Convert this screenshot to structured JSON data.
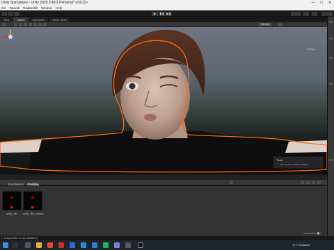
{
  "window": {
    "title": "Unity Standalone - Unity 2020.3.41f1 Personal* <DX11>",
    "controls": [
      "—",
      "☐",
      "✕"
    ]
  },
  "menu": [
    "ent",
    "Tutorial",
    "Realtoolkit",
    "Window",
    "Help"
  ],
  "toolbar": {
    "play_icon": "play-icon",
    "pause_icon": "pause-icon",
    "step_icon": "step-icon"
  },
  "tabs": [
    {
      "label": "Shot",
      "active": false
    },
    {
      "label": "Scene",
      "active": true
    },
    {
      "label": "Animation",
      "active": false
    },
    {
      "label": "Asset Store",
      "active": false
    }
  ],
  "scene": {
    "shading_mode": "Gizmos",
    "projection_label": "< Persp",
    "tools_overlay_title": "Tools",
    "tools_overlay_sub": "No custom tools available"
  },
  "project": {
    "breadcrumb": [
      "...",
      "Standalone",
      "Prefabs"
    ],
    "assets": [
      {
        "label": "unity_fbx"
      },
      {
        "label": "unity_fbx_posed"
      }
    ]
  },
  "status": {
    "message": "component is not initialized"
  },
  "taskbar": {
    "weather": "10°C  Estacion"
  },
  "colors": {
    "selection_outline": "#ff6a10",
    "editor_bg": "#383838",
    "titlebar_bg": "#f0f0f0",
    "taskbar_bg": "#20242b"
  }
}
